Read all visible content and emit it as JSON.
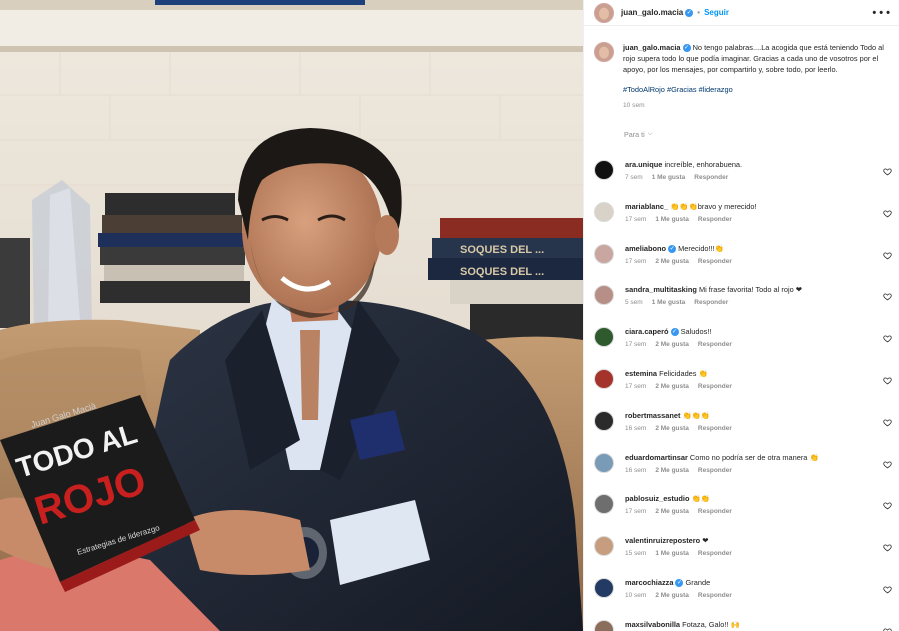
{
  "post": {
    "author": "juan_galo.macia",
    "dot": "•",
    "follow_label": "Seguir",
    "more_icon": "more-horizontal-icon",
    "caption": "No tengo palabras....La acogida que está teniendo Todo al rojo supera todo lo que podía imaginar. Gracias a cada uno de vosotros por el apoyo, por los mensajes, por compartirlo y, sobre todo, por leerlo.",
    "hashtags": [
      "#TodoAlRojo",
      "#Gracias",
      "#liderazgo"
    ],
    "time": "10 sem",
    "sort_label": "Para ti",
    "photo_book": {
      "author": "Juan Galo Macià",
      "title_line1": "TODO AL",
      "title_line2": "ROJO",
      "subtitle": "Estrategias de liderazgo"
    }
  },
  "colors": {
    "accent": "#0095f6",
    "verified": "#3897f0",
    "hashtag": "#00376b",
    "muted": "#8e8e8e",
    "book_red": "#c8201e"
  },
  "comments": [
    {
      "user": "ara.unique",
      "verified": false,
      "text": "increíble, enhorabuena.",
      "time": "7 sem",
      "likes": "1 Me gusta",
      "reply": "Responder",
      "avatar": "#111111"
    },
    {
      "user": "mariablanc_",
      "verified": false,
      "text": "👏👏👏bravo y merecido!",
      "time": "17 sem",
      "likes": "1 Me gusta",
      "reply": "Responder",
      "avatar": "#d8d2c8"
    },
    {
      "user": "ameliabono",
      "verified": true,
      "text": "Merecido!!!👏",
      "time": "17 sem",
      "likes": "2 Me gusta",
      "reply": "Responder",
      "avatar": "#c9a6a0"
    },
    {
      "user": "sandra_multitasking",
      "verified": false,
      "text": "Mi frase favorita! Todo al rojo ❤",
      "time": "5 sem",
      "likes": "1 Me gusta",
      "reply": "Responder",
      "avatar": "#b88f86"
    },
    {
      "user": "ciara.caperó",
      "verified": true,
      "text": "Saludos!!",
      "time": "17 sem",
      "likes": "2 Me gusta",
      "reply": "Responder",
      "avatar": "#2e5a2e"
    },
    {
      "user": "estemina",
      "verified": false,
      "text": "Felicidades 👏",
      "time": "17 sem",
      "likes": "2 Me gusta",
      "reply": "Responder",
      "avatar": "#a3332b"
    },
    {
      "user": "robertmassanet",
      "verified": false,
      "text": "👏👏👏",
      "time": "16 sem",
      "likes": "2 Me gusta",
      "reply": "Responder",
      "avatar": "#2b2b2b"
    },
    {
      "user": "eduardomartinsar",
      "verified": false,
      "text": "Como no podría ser de otra manera 👏",
      "time": "16 sem",
      "likes": "2 Me gusta",
      "reply": "Responder",
      "avatar": "#7a9bb8"
    },
    {
      "user": "pablosuiz_estudio",
      "verified": false,
      "text": "👏👏",
      "time": "17 sem",
      "likes": "2 Me gusta",
      "reply": "Responder",
      "avatar": "#6e6e6e"
    },
    {
      "user": "valentinruizrepostero",
      "verified": false,
      "text": "❤",
      "time": "15 sem",
      "likes": "1 Me gusta",
      "reply": "Responder",
      "avatar": "#c79d7f"
    },
    {
      "user": "marcochiazza",
      "verified": true,
      "text": "Grande",
      "time": "10 sem",
      "likes": "2 Me gusta",
      "reply": "Responder",
      "avatar": "#233a63"
    },
    {
      "user": "maxsilvabonilla",
      "verified": false,
      "text": "Fotaza, Galo!! 🙌",
      "time": "",
      "likes": "",
      "reply": "",
      "avatar": "#8a6d5a"
    }
  ]
}
